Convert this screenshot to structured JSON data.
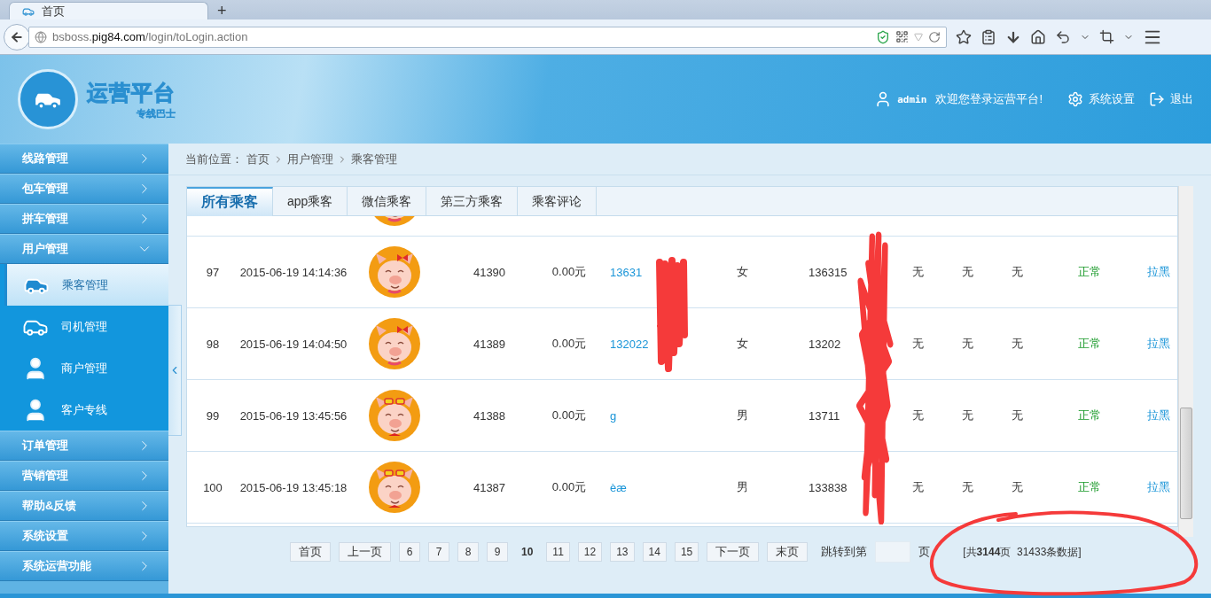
{
  "browser": {
    "tab_title": "首页",
    "new_tab": "+",
    "url": "bsboss.**pig84.com**/login/toLogin.action"
  },
  "header": {
    "logo_title": "运营平台",
    "logo_subtitle": "专线巴士",
    "user": "admin",
    "welcome": "欢迎您登录运营平台!",
    "settings": "系统设置",
    "logout": "退出"
  },
  "sidebar": {
    "items": [
      {
        "label": "线路管理",
        "expanded": false
      },
      {
        "label": "包车管理",
        "expanded": false
      },
      {
        "label": "拼车管理",
        "expanded": false
      },
      {
        "label": "用户管理",
        "expanded": true,
        "children": [
          {
            "label": "乘客管理",
            "kind": "car",
            "selected": true
          },
          {
            "label": "司机管理",
            "kind": "outline",
            "selected": false
          },
          {
            "label": "商户管理",
            "kind": "person",
            "selected": false
          },
          {
            "label": "客户专线",
            "kind": "person",
            "selected": false
          }
        ]
      },
      {
        "label": "订单管理",
        "expanded": false
      },
      {
        "label": "营销管理",
        "expanded": false
      },
      {
        "label": "帮助&反馈",
        "expanded": false
      },
      {
        "label": "系统设置",
        "expanded": false
      },
      {
        "label": "系统运营功能",
        "expanded": false
      }
    ]
  },
  "breadcrumb": {
    "label": "当前位置：",
    "path": [
      "首页",
      "用户管理",
      "乘客管理"
    ]
  },
  "tabs": [
    {
      "label": "所有乘客",
      "selected": true
    },
    {
      "label": "app乘客",
      "selected": false
    },
    {
      "label": "微信乘客",
      "selected": false
    },
    {
      "label": "第三方乘客",
      "selected": false
    },
    {
      "label": "乘客评论",
      "selected": false
    }
  ],
  "table": {
    "rows": [
      {
        "avatar": {
          "kind": "bow"
        }
      },
      {
        "no": "97",
        "time": "2015-06-19 14:14:36",
        "avatar": {
          "kind": "bow"
        },
        "id": "41390",
        "balance": "0.00元",
        "nickname": "13631",
        "gender": "女",
        "phone": "136315",
        "column_9": "无",
        "column_10": "无",
        "column_11": "无",
        "status": "正常",
        "action": "拉黑"
      },
      {
        "no": "98",
        "time": "2015-06-19 14:04:50",
        "avatar": {
          "kind": "bow"
        },
        "id": "41389",
        "balance": "0.00元",
        "nickname": "132022",
        "gender": "女",
        "phone": "13202",
        "column_9": "无",
        "column_10": "无",
        "column_11": "无",
        "status": "正常",
        "action": "拉黑"
      },
      {
        "no": "99",
        "time": "2015-06-19 13:45:56",
        "avatar": {
          "kind": "glasses"
        },
        "id": "41388",
        "balance": "0.00元",
        "nickname": "g",
        "gender": "男",
        "phone": "13711",
        "column_9": "无",
        "column_10": "无",
        "column_11": "无",
        "status": "正常",
        "action": "拉黑"
      },
      {
        "no": "100",
        "time": "2015-06-19 13:45:18",
        "avatar": {
          "kind": "glasses"
        },
        "id": "41387",
        "balance": "0.00元",
        "nickname": "èæ",
        "gender": "男",
        "phone": "133838",
        "column_9": "无",
        "column_10": "无",
        "column_11": "无",
        "status": "正常",
        "action": "拉黑"
      }
    ]
  },
  "pagination": {
    "first": "首页",
    "prev": "上一页",
    "pages": [
      {
        "label": "6",
        "selected": false
      },
      {
        "label": "7",
        "selected": false
      },
      {
        "label": "8",
        "selected": false
      },
      {
        "label": "9",
        "selected": false
      },
      {
        "label": "10",
        "selected": true
      },
      {
        "label": "11",
        "selected": false
      },
      {
        "label": "12",
        "selected": false
      },
      {
        "label": "13",
        "selected": false
      },
      {
        "label": "14",
        "selected": false
      },
      {
        "label": "15",
        "selected": false
      }
    ],
    "next": "下一页",
    "last": "末页",
    "jump_label": "跳转到第",
    "jump_unit": "页",
    "summary": "[共**3144**页  31433条数据]"
  }
}
